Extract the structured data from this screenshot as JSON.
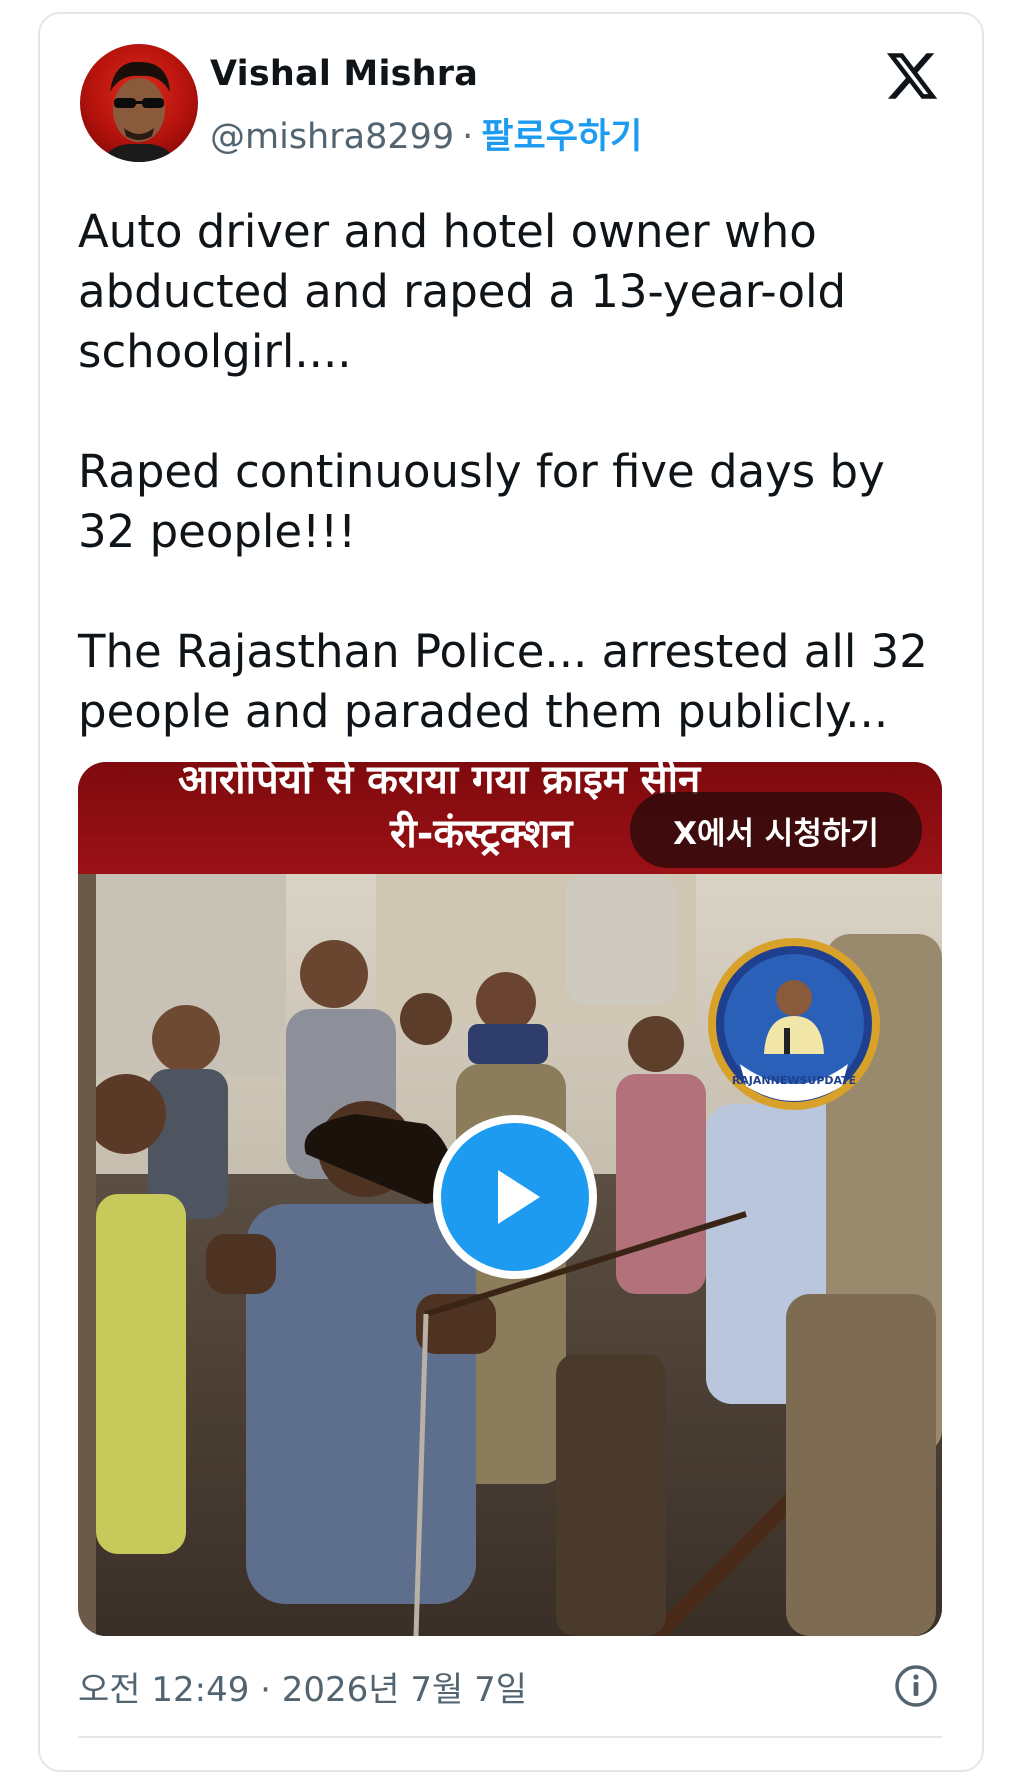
{
  "author": {
    "display_name": "Vishal Mishra",
    "handle": "@mishra8299",
    "separator": "·",
    "follow_label": "팔로우하기",
    "avatar_icon": "profile-avatar"
  },
  "platform_icon": "x-logo-icon",
  "tweet": {
    "paragraphs": [
      "Auto driver and hotel owner who abducted and raped a 13-year-old schoolgirl....",
      "Raped continuously for five days by 32 people!!!",
      "The Rajasthan Police... arrested all 32 people and paraded them publicly..."
    ]
  },
  "media": {
    "headline_line1": "आरोपियों से कराया गया क्राइम सीन",
    "headline_line2": "री-कंस्ट्रक्शन",
    "watch_label": "X에서 시청하기",
    "watermark_text": "RAJANNEWSUPDATE",
    "play_icon": "play-icon",
    "colors": {
      "header_red": "#8b0d10",
      "play_blue": "#1d9bf0"
    }
  },
  "footer": {
    "timestamp": "오전 12:49 · 2026년 7월 7일",
    "info_icon": "info-icon"
  }
}
